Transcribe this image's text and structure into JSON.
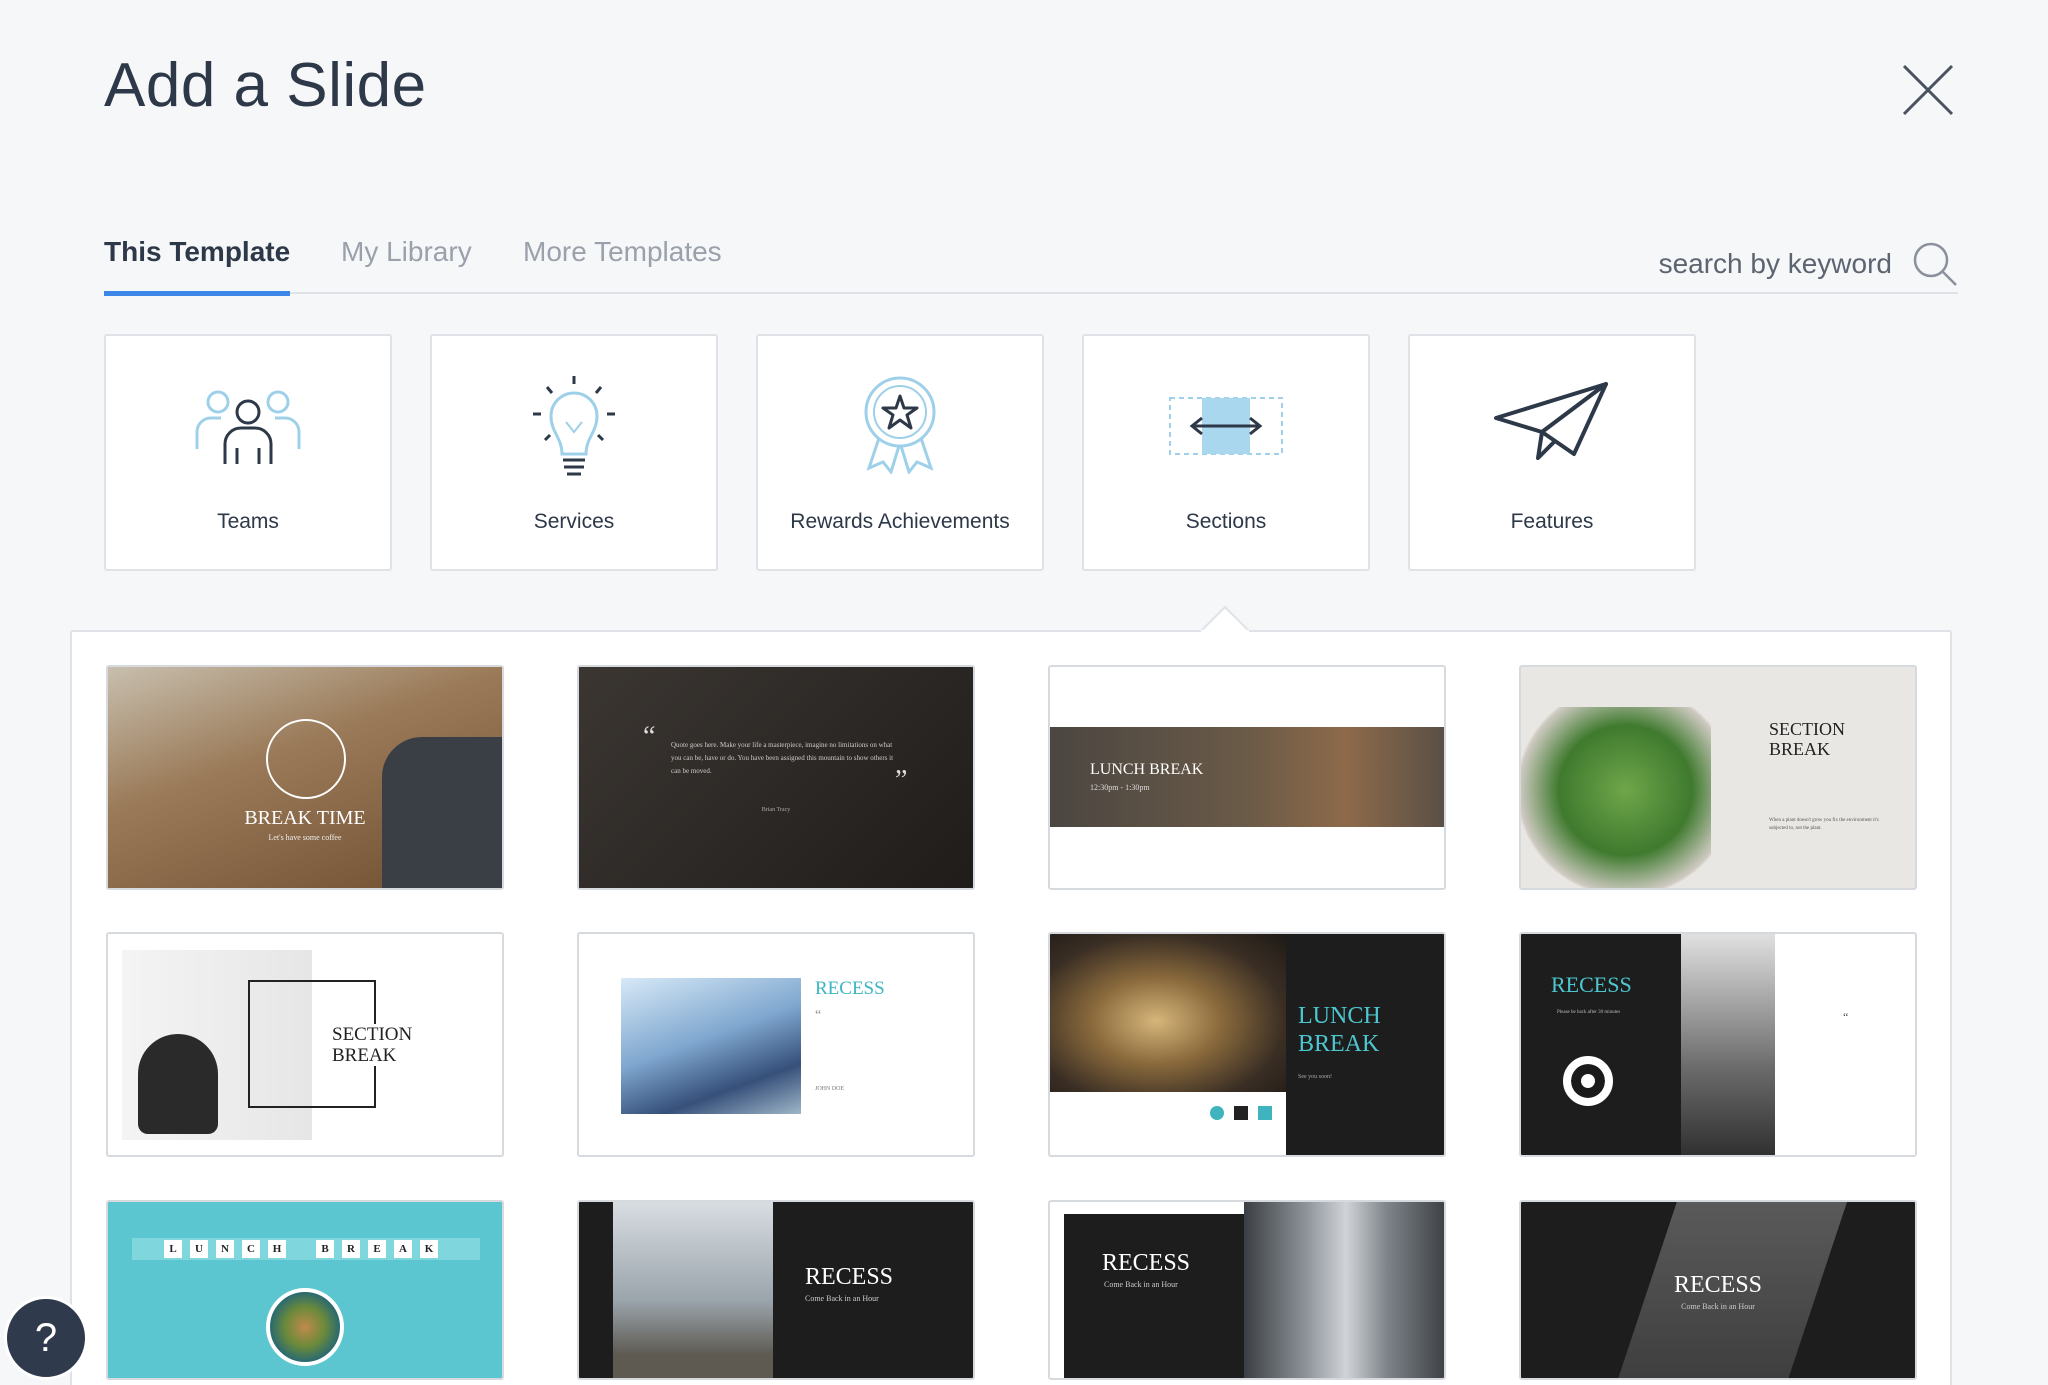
{
  "dialog": {
    "title": "Add a Slide"
  },
  "tabs": [
    {
      "label": "This Template"
    },
    {
      "label": "My Library"
    },
    {
      "label": "More Templates"
    }
  ],
  "search": {
    "placeholder": "search by keyword"
  },
  "categories": [
    {
      "label": "Teams",
      "icon": "team-icon"
    },
    {
      "label": "Services",
      "icon": "lightbulb-icon"
    },
    {
      "label": "Rewards Achievements",
      "icon": "award-ribbon-icon"
    },
    {
      "label": "Sections",
      "icon": "section-arrows-icon"
    },
    {
      "label": "Features",
      "icon": "paper-plane-icon"
    }
  ],
  "thumbnails": [
    {
      "title": "BREAK TIME",
      "subtitle": "Let's have some coffee"
    },
    {
      "quote": "Quote goes here. Make your life a masterpiece, imagine no limitations on what you can be, have or do. You have been assigned this mountain to show others it can be moved.",
      "author": "Brian Tracy"
    },
    {
      "title": "LUNCH BREAK",
      "subtitle": "12:30pm - 1:30pm"
    },
    {
      "title": "SECTION BREAK",
      "subtitle": "When a plant doesn't grow you fix the environment it's subjected to, not the plant."
    },
    {
      "title": "SECTION BREAK"
    },
    {
      "title": "RECESS",
      "author": "JOHN DOE"
    },
    {
      "title": "LUNCH BREAK",
      "subtitle": "See you soon!"
    },
    {
      "title": "RECESS",
      "subtitle": "Please be back after 30 minutes"
    },
    {
      "letters": [
        "L",
        "U",
        "N",
        "C",
        "H",
        "B",
        "R",
        "E",
        "A",
        "K"
      ]
    },
    {
      "title": "RECESS",
      "subtitle": "Come Back in an Hour"
    },
    {
      "title": "RECESS",
      "subtitle": "Come Back in an Hour"
    },
    {
      "title": "RECESS",
      "subtitle": "Come Back in an Hour"
    }
  ],
  "help": {
    "label": "?"
  },
  "colors": {
    "accent": "#3b86e6",
    "icon_light": "#9fd0ea",
    "text_dark": "#2d3848",
    "teal": "#5bc6d0"
  }
}
